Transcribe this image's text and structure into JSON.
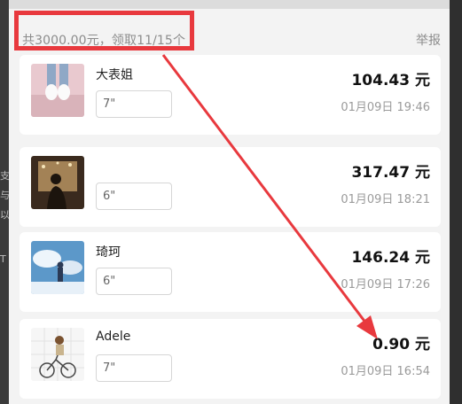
{
  "summary": {
    "text": "共3000.00元，领取11/15个",
    "report_label": "举报"
  },
  "claims": [
    {
      "name": "大表姐",
      "voice_duration": "7\"",
      "amount": "104.43 元",
      "time": "01月09日 19:46",
      "avatar": "shoes-photo-avatar"
    },
    {
      "name": "",
      "voice_duration": "6\"",
      "amount": "317.47 元",
      "time": "01月09日 18:21",
      "avatar": "silhouette-photo-avatar"
    },
    {
      "name": "琦珂",
      "voice_duration": "6\"",
      "amount": "146.24 元",
      "time": "01月09日 17:26",
      "avatar": "sky-photo-avatar"
    },
    {
      "name": "Adele",
      "voice_duration": "7\"",
      "amount": "0.90 元",
      "time": "01月09日 16:54",
      "avatar": "sketch-bike-avatar"
    }
  ],
  "colors": {
    "annotation_red": "#e8393e",
    "panel_background": "#f3f3f3",
    "card_background": "#ffffff"
  }
}
